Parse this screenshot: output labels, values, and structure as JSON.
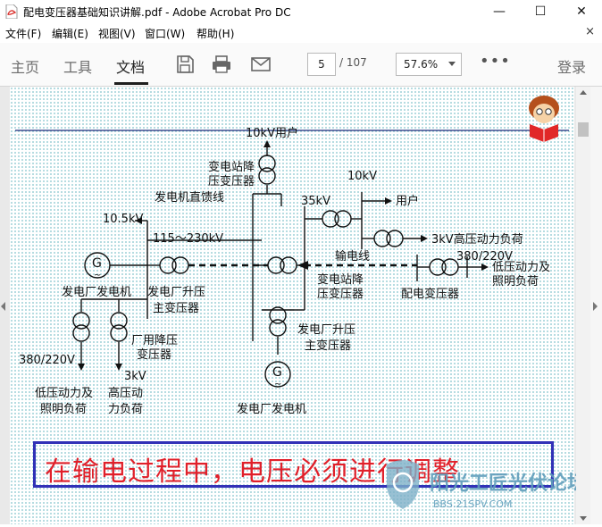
{
  "window": {
    "title": "配电变压器基础知识讲解.pdf - Adobe Acrobat Pro DC",
    "minimize": "—",
    "maximize": "☐",
    "close": "✕"
  },
  "menu": {
    "items": [
      "文件(F)",
      "编辑(E)",
      "视图(V)",
      "窗口(W)",
      "帮助(H)"
    ],
    "close_doc": "×"
  },
  "toolbar": {
    "tabs": [
      "主页",
      "工具",
      "文档"
    ],
    "active_tab": "文档",
    "page_current": "5",
    "page_total": "/ 107",
    "zoom": "57.6%",
    "more": "•••",
    "signin": "登录"
  },
  "diagram": {
    "labels": {
      "user_10kv_top": "10kV用户",
      "step_down_station": "变电站降",
      "step_down_station_2": "压变压器",
      "gen_feeder": "发电机直馈线",
      "kv10_5": "10.5kV",
      "kv10": "10kV",
      "user": "用户",
      "kv35": "35kV",
      "hv_load_3kv": "3kV高压动力负荷",
      "transmission_line": "输电线",
      "range_115_230": "115～230kV",
      "v380_220_right": "380/220V",
      "lv_load_right_1": "低压动力及",
      "lv_load_right_2": "照明负荷",
      "plant_gen_left": "发电厂发电机",
      "plant_step_up_left_1": "发电厂升压",
      "plant_step_up_left_2": "主变压器",
      "station_step_down_mid_1": "变电站降",
      "station_step_down_mid_2": "压变压器",
      "distribution_transformer": "配电变压器",
      "plant_aux_1": "厂用降压",
      "plant_aux_2": "变压器",
      "v380_220_left": "380/220V",
      "kv3": "3kV",
      "plant_step_up_mid_1": "发电厂升压",
      "plant_step_up_mid_2": "主变压器",
      "lv_load_left_1": "低压动力及",
      "lv_load_left_2": "照明负荷",
      "hv_load_left_1": "高压动",
      "hv_load_left_2": "力负荷",
      "plant_gen_mid": "发电厂发电机",
      "gen_symbol": "G"
    },
    "banner": "在输电过程中，电压必须进行调整"
  },
  "watermark": {
    "line1": "阳光工匠光伏论坛",
    "line2": "BBS.21SPV.COM"
  },
  "colors": {
    "banner_text": "#e0202a",
    "banner_border": "#3131b7",
    "page_dots": "#9dd0d7",
    "pdf_red": "#d9302c"
  }
}
